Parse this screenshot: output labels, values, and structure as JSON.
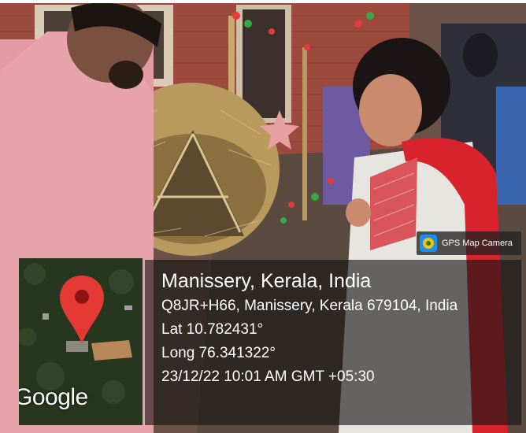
{
  "badge": {
    "label": "GPS Map Camera"
  },
  "map": {
    "provider_label": "Google"
  },
  "location": {
    "title": "Manissery, Kerala, India",
    "address": "Q8JR+H66, Manissery, Kerala 679104, India",
    "latitude": "Lat 10.782431°",
    "longitude": "Long 76.341322°",
    "datetime": "23/12/22 10:01 AM GMT +05:30"
  },
  "colors": {
    "overlay": "#141414",
    "text": "#ffffff",
    "map_pin": "#e53935",
    "badge_logo": "#1c8ef0"
  },
  "icons": [
    "map-pin-icon",
    "gps-camera-logo-icon"
  ]
}
